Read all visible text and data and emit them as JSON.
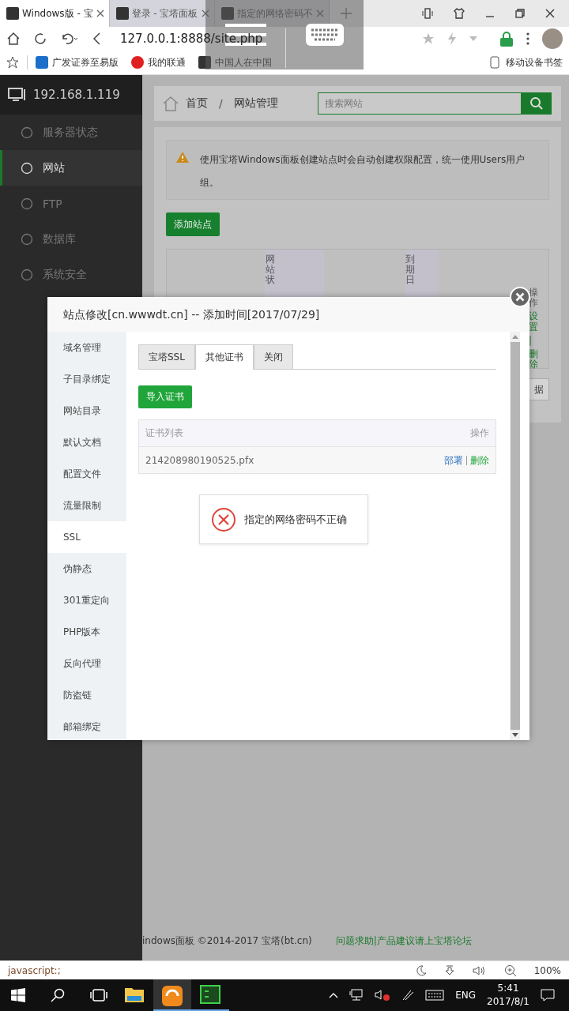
{
  "browser": {
    "tabs": [
      {
        "title": "Windows版 - 宝",
        "selected": true
      },
      {
        "title": "登录 - 宝塔面板",
        "selected": false
      },
      {
        "title": "指定的网络密码不",
        "selected": false
      }
    ],
    "address": "127.0.0.1:8888/site.php",
    "bookmarks": [
      "广发证券至易版",
      "我的联通",
      "中国人在中国"
    ],
    "mobile_bookmarks": "移动设备书签"
  },
  "sidebar": {
    "host": "192.168.1.119",
    "items": [
      {
        "label": "服务器状态",
        "selected": false
      },
      {
        "label": "网站",
        "selected": true
      },
      {
        "label": "FTP",
        "selected": false
      },
      {
        "label": "数据库",
        "selected": false
      },
      {
        "label": "系统安全",
        "selected": false
      }
    ]
  },
  "breadcrumb": {
    "home": "首页",
    "separator": "/",
    "current": "网站管理"
  },
  "search": {
    "placeholder": "搜索网站"
  },
  "notice": "使用宝塔Windows面板创建站点时会自动创建权限配置，统一使用Users用户组。",
  "add_button": "添加站点",
  "table": {
    "columns": [
      "网站状",
      "到期日",
      "操作"
    ],
    "row_actions": [
      "设置",
      "|",
      "删除"
    ],
    "side_button": "据"
  },
  "modal": {
    "title": "站点修改[cn.wwwdt.cn] -- 添加时间[2017/07/29]",
    "nav": [
      {
        "label": "域名管理",
        "selected": false
      },
      {
        "label": "子目录绑定",
        "selected": false
      },
      {
        "label": "网站目录",
        "selected": false
      },
      {
        "label": "默认文档",
        "selected": false
      },
      {
        "label": "配置文件",
        "selected": false
      },
      {
        "label": "流量限制",
        "selected": false
      },
      {
        "label": "SSL",
        "selected": true
      },
      {
        "label": "伪静态",
        "selected": false
      },
      {
        "label": "301重定向",
        "selected": false
      },
      {
        "label": "PHP版本",
        "selected": false
      },
      {
        "label": "反向代理",
        "selected": false
      },
      {
        "label": "防盗链",
        "selected": false
      },
      {
        "label": "邮箱绑定",
        "selected": false
      }
    ],
    "tabs": [
      {
        "label": "宝塔SSL",
        "selected": false
      },
      {
        "label": "其他证书",
        "selected": true
      },
      {
        "label": "关闭",
        "selected": false
      }
    ],
    "import_button": "导入证书",
    "cert_table": {
      "columns": [
        "证书列表",
        "操作"
      ],
      "rows": [
        {
          "name": "214208980190525.pfx",
          "actions": [
            "部署",
            "删除"
          ]
        }
      ]
    },
    "toast": {
      "kind": "error",
      "message": "指定的网络密码不正确"
    }
  },
  "footer": {
    "copyright": "indows面板 ©2014-2017 宝塔(bt.cn)",
    "link": "问题求助|产品建议请上宝塔论坛"
  },
  "status_bar": {
    "url": "javascript:;",
    "zoom": "100%"
  },
  "taskbar": {
    "language": "ENG",
    "time": "5:41",
    "date": "2017/8/1"
  }
}
